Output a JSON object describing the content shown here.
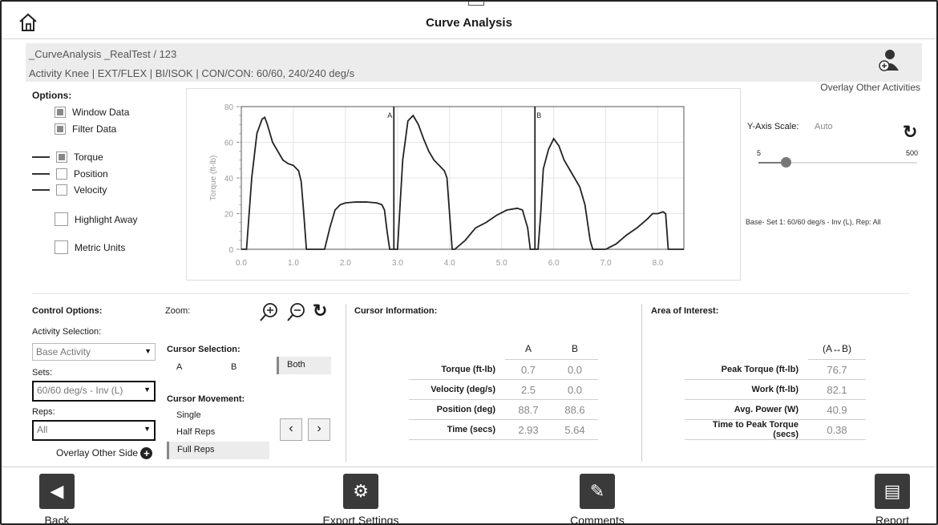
{
  "header": {
    "title": "Curve Analysis"
  },
  "info": {
    "path": "_CurveAnalysis _RealTest / 123",
    "activity": "Activity  Knee | EXT/FLEX | BI/ISOK | CON/CON: 60/60, 240/240 deg/s",
    "overlay_label": "Overlay Other Activities"
  },
  "options": {
    "title": "Options:",
    "window_data": "Window Data",
    "filter_data": "Filter Data",
    "torque": "Torque",
    "position": "Position",
    "velocity": "Velocity",
    "highlight_away": "Highlight Away",
    "metric_units": "Metric Units"
  },
  "chart_data": {
    "type": "line",
    "ylabel": "Torque (ft-lb)",
    "xlabel": "",
    "xlim": [
      0,
      8.5
    ],
    "ylim": [
      0,
      80
    ],
    "x_ticks": [
      "0.0",
      "1.0",
      "2.0",
      "3.0",
      "4.0",
      "5.0",
      "6.0",
      "7.0",
      "8.0"
    ],
    "y_ticks": [
      "0",
      "20",
      "40",
      "60",
      "80"
    ],
    "cursors": [
      {
        "label": "A",
        "x": 2.93
      },
      {
        "label": "B",
        "x": 5.64
      }
    ],
    "series": [
      {
        "x": [
          0,
          0.1,
          0.2,
          0.3,
          0.4,
          0.45,
          0.5,
          0.6,
          0.7,
          0.8,
          0.9,
          1.0,
          1.1,
          1.15,
          1.2,
          1.25,
          1.3,
          1.5,
          1.6,
          1.7,
          1.8,
          1.9,
          2.0,
          2.2,
          2.4,
          2.6,
          2.7,
          2.75,
          2.8,
          2.85,
          2.9,
          3.0,
          3.1,
          3.2,
          3.3,
          3.4,
          3.5,
          3.6,
          3.7,
          3.8,
          3.9,
          3.95,
          4.0,
          4.05,
          4.1,
          4.3,
          4.5,
          4.7,
          4.9,
          5.1,
          5.3,
          5.4,
          5.5,
          5.55,
          5.6,
          5.7,
          5.75,
          5.8,
          5.9,
          6.0,
          6.1,
          6.2,
          6.3,
          6.4,
          6.5,
          6.6,
          6.7,
          6.75,
          6.8,
          6.85,
          6.9,
          7.0,
          7.2,
          7.4,
          7.6,
          7.8,
          7.9,
          8.0,
          8.1,
          8.15,
          8.2,
          8.5
        ],
        "values": [
          0,
          0,
          40,
          65,
          73,
          74,
          70,
          60,
          55,
          50,
          48,
          47,
          44,
          38,
          20,
          0,
          0,
          0,
          0,
          12,
          22,
          25,
          26,
          26.5,
          26.5,
          26,
          25,
          22,
          10,
          0,
          0,
          0,
          50,
          72,
          75,
          70,
          62,
          55,
          50,
          47,
          44,
          40,
          20,
          0,
          0,
          5,
          12,
          15,
          19,
          22,
          23,
          22,
          12,
          0,
          0,
          0,
          20,
          45,
          56,
          62,
          58,
          50,
          45,
          40,
          35,
          25,
          5,
          0,
          0,
          0,
          0,
          0,
          3,
          8,
          12,
          17,
          20,
          20,
          21,
          20,
          0,
          0
        ]
      }
    ]
  },
  "yaxis": {
    "label": "Y-Axis Scale:",
    "value": "Auto",
    "min": "5",
    "max": "500",
    "slider_value": 5
  },
  "base_info": "Base- Set 1: 60/60 deg/s - Inv (L), Rep: All",
  "control": {
    "title": "Control Options:",
    "zoom": "Zoom:",
    "activity_label": "Activity Selection:",
    "activity_value": "Base Activity",
    "sets_label": "Sets:",
    "sets_value": "60/60 deg/s - Inv (L)",
    "reps_label": "Reps:",
    "reps_value": "All",
    "overlay_side": "Overlay Other Side",
    "cursor_selection": "Cursor Selection:",
    "cs_a": "A",
    "cs_b": "B",
    "cs_both": "Both",
    "cursor_movement": "Cursor Movement:",
    "single": "Single",
    "half_reps": "Half Reps",
    "full_reps": "Full Reps"
  },
  "cursor_info": {
    "title": "Cursor Information:",
    "col_a": "A",
    "col_b": "B",
    "rows": [
      {
        "label": "Torque (ft-lb)",
        "a": "0.7",
        "b": "0.0"
      },
      {
        "label": "Velocity (deg/s)",
        "a": "2.5",
        "b": "0.0"
      },
      {
        "label": "Position (deg)",
        "a": "88.7",
        "b": "88.6"
      },
      {
        "label": "Time (secs)",
        "a": "2.93",
        "b": "5.64"
      }
    ]
  },
  "aoi": {
    "title": "Area of Interest:",
    "col": "(A↔B)",
    "rows": [
      {
        "label": "Peak Torque (ft-lb)",
        "v": "76.7"
      },
      {
        "label": "Work (ft-lb)",
        "v": "82.1"
      },
      {
        "label": "Avg. Power (W)",
        "v": "40.9"
      },
      {
        "label": "Time to Peak Torque (secs)",
        "v": "0.38"
      }
    ]
  },
  "bottom": {
    "back": "Back",
    "export": "Export Settings",
    "comments": "Comments",
    "report": "Report"
  }
}
